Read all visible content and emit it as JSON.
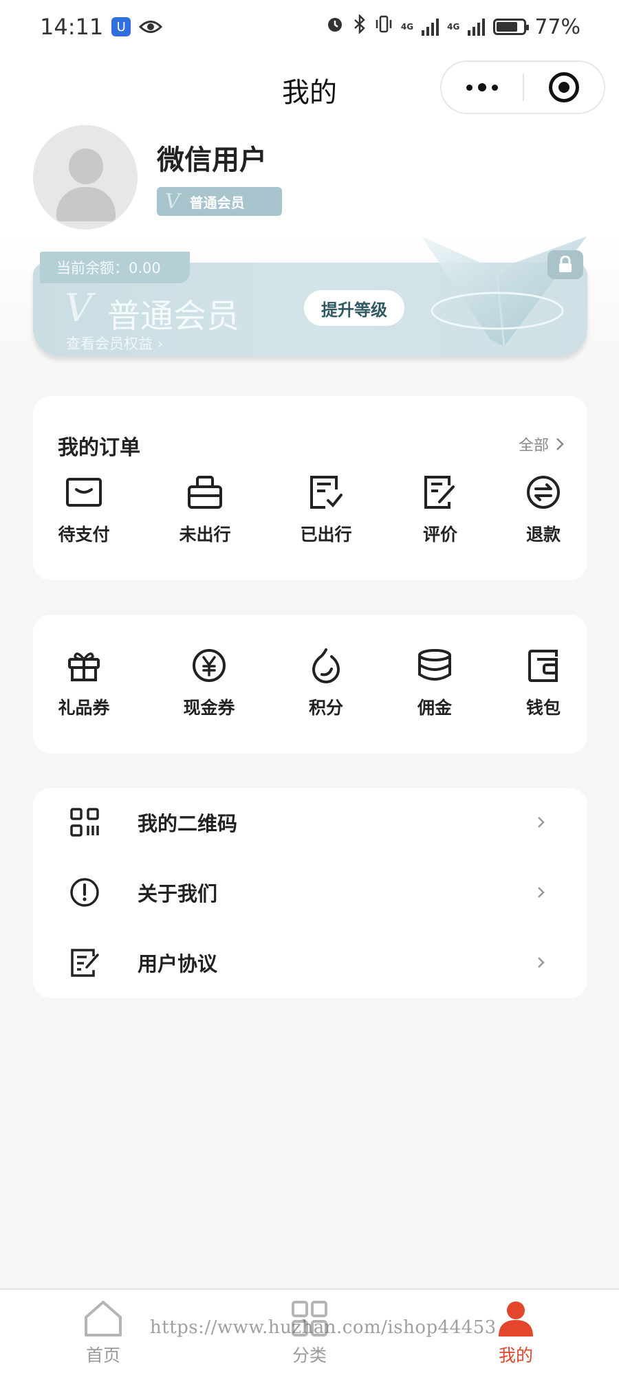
{
  "status_bar": {
    "time": "14:11",
    "app_badge": "U",
    "network_1": "4G",
    "network_2": "4G",
    "battery_percent": "77%",
    "battery_level": 0.77
  },
  "nav": {
    "title": "我的"
  },
  "profile": {
    "name": "微信用户",
    "member_tag_v": "V",
    "member_tag": "普通会员"
  },
  "member_card": {
    "balance": "当前余额：0.00",
    "v_mark": "V",
    "level": "普通会员",
    "benefits": "查看会员权益 ›",
    "upgrade": "提升等级"
  },
  "orders": {
    "title": "我的订单",
    "all": "全部",
    "items": [
      {
        "label": "待支付",
        "icon": "wallet-card-icon"
      },
      {
        "label": "未出行",
        "icon": "briefcase-icon"
      },
      {
        "label": "已出行",
        "icon": "checked-doc-icon"
      },
      {
        "label": "评价",
        "icon": "edit-note-icon"
      },
      {
        "label": "退款",
        "icon": "refund-arrows-icon"
      }
    ]
  },
  "assets": {
    "items": [
      {
        "label": "礼品券",
        "icon": "gift-icon"
      },
      {
        "label": "现金券",
        "icon": "yuan-coin-icon"
      },
      {
        "label": "积分",
        "icon": "drop-icon"
      },
      {
        "label": "佣金",
        "icon": "coins-stack-icon"
      },
      {
        "label": "钱包",
        "icon": "wallet-icon"
      }
    ]
  },
  "menu": {
    "items": [
      {
        "label": "我的二维码",
        "icon": "qr-code-icon"
      },
      {
        "label": "关于我们",
        "icon": "info-icon"
      },
      {
        "label": "用户协议",
        "icon": "agreement-icon"
      }
    ]
  },
  "tabbar": {
    "items": [
      {
        "label": "首页",
        "icon": "home-icon"
      },
      {
        "label": "分类",
        "icon": "category-icon"
      },
      {
        "label": "我的",
        "icon": "user-icon"
      }
    ],
    "active_color": "#e2472c"
  },
  "watermark": "https://www.huzhan.com/ishop44453"
}
